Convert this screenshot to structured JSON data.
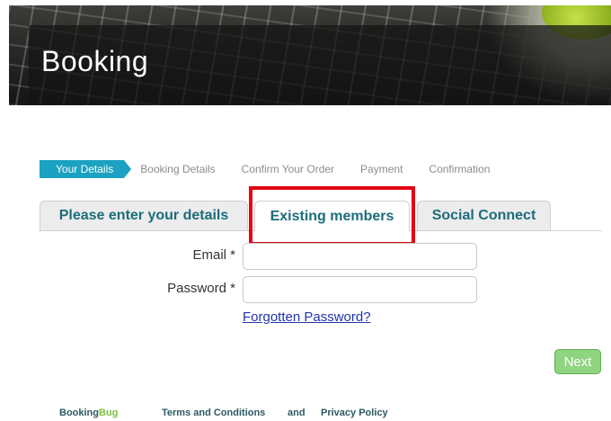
{
  "header": {
    "title": "Booking"
  },
  "steps": {
    "active": "Your Details",
    "items": [
      "Booking Details",
      "Confirm Your Order",
      "Payment",
      "Confirmation"
    ]
  },
  "tabs": [
    {
      "label": "Please enter your details"
    },
    {
      "label": "Existing members"
    },
    {
      "label": "Social Connect"
    }
  ],
  "form": {
    "email_label": "Email *",
    "email_value": "",
    "password_label": "Password *",
    "password_value": "",
    "forgot_link": "Forgotten Password?",
    "next_label": "Next"
  },
  "footer": {
    "brand_part1": "Booking",
    "brand_part2": "Bug",
    "terms": "Terms and Conditions",
    "and": "and",
    "privacy": "Privacy Policy"
  },
  "colors": {
    "accent": "#1ba1c1",
    "tab_text": "#1c6c7c",
    "highlight": "#e30613",
    "next_button": "#8fd481",
    "brand_green": "#7dbf44"
  }
}
